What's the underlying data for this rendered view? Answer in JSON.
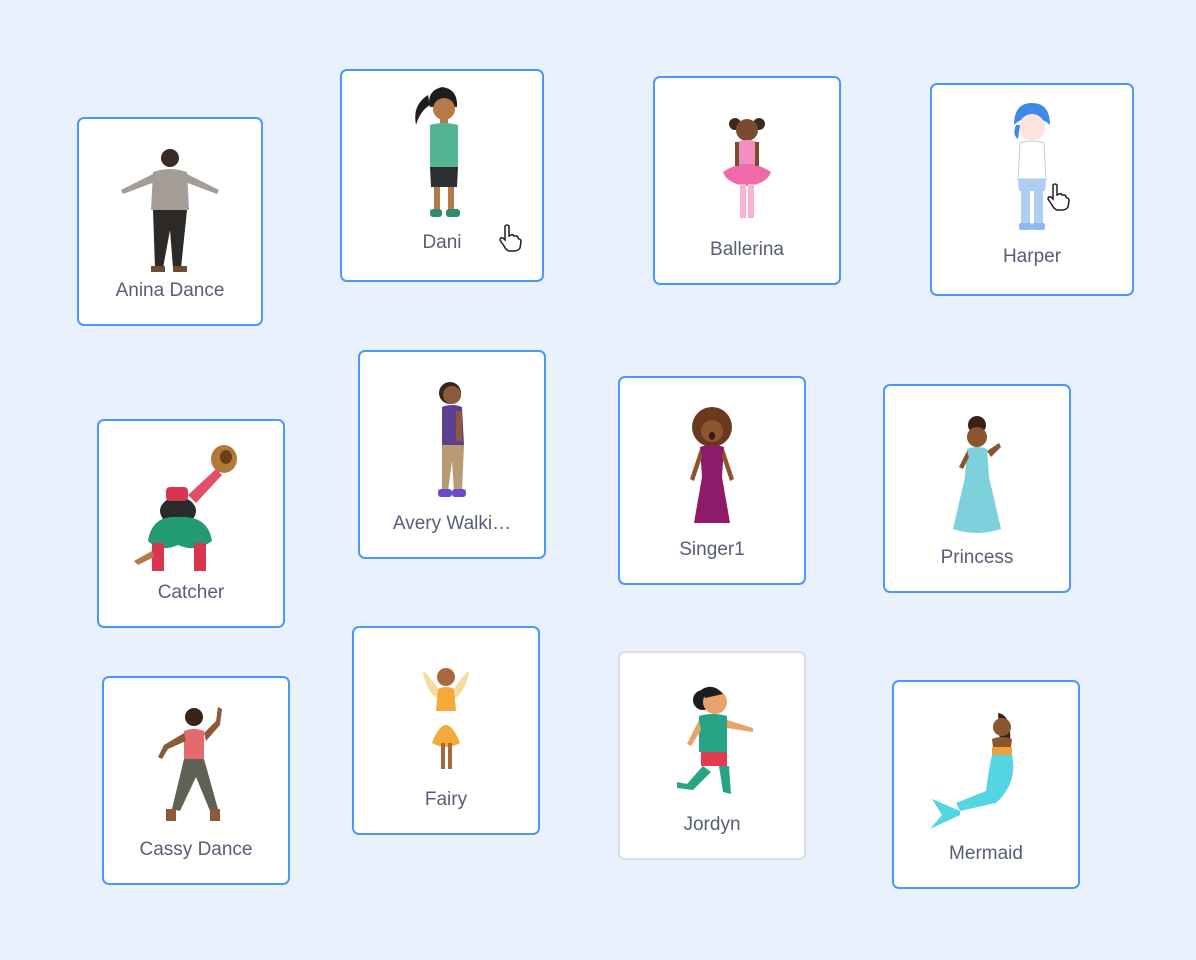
{
  "sprites": [
    {
      "label": "Anina Dance",
      "icon": "dancer-photo-icon"
    },
    {
      "label": "Dani",
      "icon": "girl-ponytail-icon"
    },
    {
      "label": "Ballerina",
      "icon": "ballerina-icon"
    },
    {
      "label": "Harper",
      "icon": "girl-blue-hair-icon"
    },
    {
      "label": "Catcher",
      "icon": "baseball-catcher-icon"
    },
    {
      "label": "Avery Walki…",
      "icon": "walking-girl-icon"
    },
    {
      "label": "Singer1",
      "icon": "singer-icon"
    },
    {
      "label": "Princess",
      "icon": "princess-icon"
    },
    {
      "label": "Cassy Dance",
      "icon": "dancer-photo-icon"
    },
    {
      "label": "Fairy",
      "icon": "fairy-icon"
    },
    {
      "label": "Jordyn",
      "icon": "running-girl-icon"
    },
    {
      "label": "Mermaid",
      "icon": "mermaid-icon"
    }
  ],
  "colors": {
    "background": "#e9f1fc",
    "card_border": "#4c97ff",
    "label": "#575e75"
  }
}
